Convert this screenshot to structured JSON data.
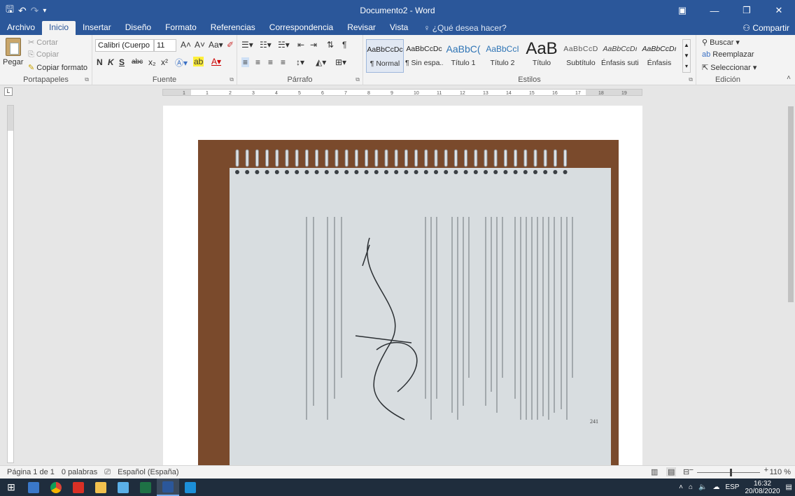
{
  "window": {
    "title": "Documento2 - Word",
    "qat_save_icon": "save-icon",
    "qat_undo_icon": "undo-icon",
    "qat_redo_icon": "redo-icon"
  },
  "tabs": [
    "Archivo",
    "Inicio",
    "Insertar",
    "Diseño",
    "Formato",
    "Referencias",
    "Correspondencia",
    "Revisar",
    "Vista"
  ],
  "active_tab": "Inicio",
  "tell_me": "¿Qué desea hacer?",
  "share": "Compartir",
  "clipboard": {
    "paste": "Pegar",
    "cut": "Cortar",
    "copy": "Copiar",
    "format_painter": "Copiar formato",
    "label": "Portapapeles"
  },
  "font": {
    "name": "Calibri (Cuerpo",
    "size": "11",
    "bold": "N",
    "italic": "K",
    "underline": "S",
    "strike": "abc",
    "subscript": "x₂",
    "superscript": "x²",
    "label": "Fuente"
  },
  "paragraph": {
    "label": "Párrafo"
  },
  "styles": {
    "label": "Estilos",
    "items": [
      {
        "sample": "AaBbCcDc",
        "name": "¶ Normal"
      },
      {
        "sample": "AaBbCcDc",
        "name": "¶ Sin espa..."
      },
      {
        "sample": "AaBbC(",
        "name": "Título 1"
      },
      {
        "sample": "AaBbCcI",
        "name": "Título 2"
      },
      {
        "sample": "AaB",
        "name": "Título"
      },
      {
        "sample": "AaBbCcD",
        "name": "Subtítulo"
      },
      {
        "sample": "AaBbCcDı",
        "name": "Énfasis sutil"
      },
      {
        "sample": "AaBbCcDı",
        "name": "Énfasis"
      }
    ]
  },
  "editing": {
    "find": "Buscar",
    "replace": "Reemplazar",
    "select": "Seleccionar",
    "label": "Edición"
  },
  "ruler": {
    "h_numbers": [
      "1",
      "1",
      "2",
      "3",
      "4",
      "5",
      "6",
      "7",
      "8",
      "9",
      "10",
      "11",
      "12",
      "13",
      "14",
      "15",
      "16",
      "17",
      "18",
      "19"
    ],
    "tab_selector": "L"
  },
  "status": {
    "page": "Página 1 de 1",
    "words": "0 palabras",
    "language": "Español (España)",
    "zoom": "110 %"
  },
  "taskbar": {
    "language": "ESP",
    "time": "16:32",
    "date": "20/08/2020"
  },
  "colors": {
    "ribbon_blue": "#2b579a",
    "ribbon_bg": "#f3f3f3",
    "taskbar": "#1f2d3d"
  }
}
